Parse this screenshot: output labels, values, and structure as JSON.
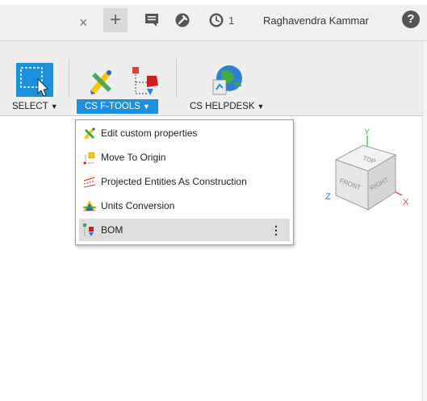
{
  "topbar": {
    "tab_close": "×",
    "new_tab": "+",
    "job_count": "1",
    "user_name": "Raghavendra Kammar",
    "help_glyph": "?"
  },
  "ribbon": {
    "select_label": "SELECT",
    "cs_ftools_label": "CS F-TOOLS",
    "cs_helpdesk_label": "CS HELPDESK",
    "caret": "▼"
  },
  "menu": {
    "items": [
      {
        "label": "Edit custom properties",
        "icon": "custom-properties-icon"
      },
      {
        "label": "Move To Origin",
        "icon": "move-origin-icon"
      },
      {
        "label": "Projected Entities As Construction",
        "icon": "projected-entities-icon"
      },
      {
        "label": "Units Conversion",
        "icon": "units-conversion-icon"
      },
      {
        "label": "BOM",
        "icon": "bom-icon"
      }
    ],
    "kebab": "⋮"
  },
  "viewcube": {
    "top": "TOP",
    "front": "FRONT",
    "right": "RIGHT",
    "axis_x": "X",
    "axis_y": "Y",
    "axis_z": "Z"
  },
  "colors": {
    "accent": "#1b90dc",
    "axis_x": "#e8423f",
    "axis_y": "#5cc45a",
    "axis_z": "#3b6fd8"
  }
}
